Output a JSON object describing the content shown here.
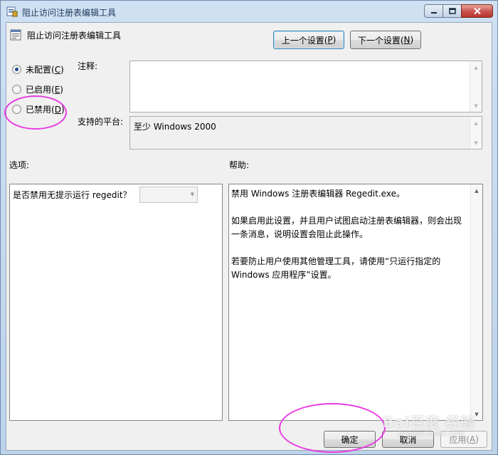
{
  "window": {
    "title": "阻止访问注册表编辑工具",
    "icon": "policy-icon",
    "caption_buttons": [
      "minimize",
      "maximize",
      "close"
    ]
  },
  "header": {
    "title": "阻止访问注册表编辑工具",
    "icon": "policy-setting-icon"
  },
  "nav": {
    "prev_label": "上一个设置(",
    "prev_key": "P",
    "prev_suffix": ")",
    "next_label": "下一个设置(",
    "next_key": "N",
    "next_suffix": ")"
  },
  "state": {
    "options": [
      {
        "label": "未配置(",
        "key": "C",
        "suffix": ")",
        "checked": true
      },
      {
        "label": "已启用(",
        "key": "E",
        "suffix": ")",
        "checked": false
      },
      {
        "label": "已禁用(",
        "key": "D",
        "suffix": ")",
        "checked": false
      }
    ]
  },
  "comment": {
    "label": "注释:",
    "value": ""
  },
  "platform": {
    "label": "支持的平台:",
    "value": "至少 Windows 2000"
  },
  "options_section": {
    "label": "选项:",
    "question": "是否禁用无提示运行 regedit？",
    "combo_value": ""
  },
  "help_section": {
    "label": "帮助:",
    "text": "禁用 Windows 注册表编辑器 Regedit.exe。\n\n如果启用此设置，并且用户试图启动注册表编辑器，则会出现一条消息，说明设置会阻止此操作。\n\n若要防止用户使用其他管理工具，请使用“只运行指定的 Windows 应用程序”设置。"
  },
  "footer": {
    "ok_label": "确定",
    "cancel_label": "取消",
    "apply_label": "应用(",
    "apply_key": "A",
    "apply_suffix": ")"
  },
  "watermark": {
    "brand": "Bai百度 经验",
    "url": "jingyan.baidu.com"
  },
  "colors": {
    "annotation_circle": "#e83ce0",
    "titlebar": "#bcd3ea",
    "close_button": "#c75050"
  }
}
